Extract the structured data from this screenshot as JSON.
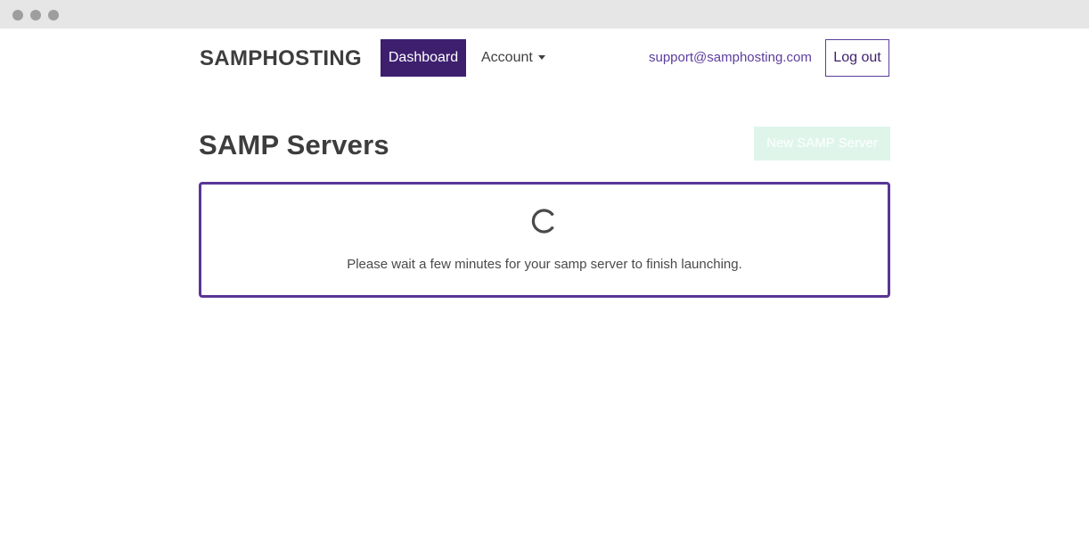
{
  "window": {
    "controls": [
      "close",
      "minimize",
      "maximize"
    ]
  },
  "navbar": {
    "brand": "SAMPHOSTING",
    "items": [
      {
        "label": "Dashboard",
        "active": true
      },
      {
        "label": "Account",
        "dropdown": true
      }
    ],
    "support_email": "support@samphosting.com",
    "logout_label": "Log out"
  },
  "main": {
    "title": "SAMP Servers",
    "new_server_label": "New SAMP Server",
    "status": {
      "icon": "spinner-icon",
      "message": "Please wait a few minutes for your samp server to finish launching."
    }
  },
  "colors": {
    "brand_purple": "#3d1f6e",
    "accent_purple": "#5a3696",
    "disabled_green": "#dff5ea"
  }
}
